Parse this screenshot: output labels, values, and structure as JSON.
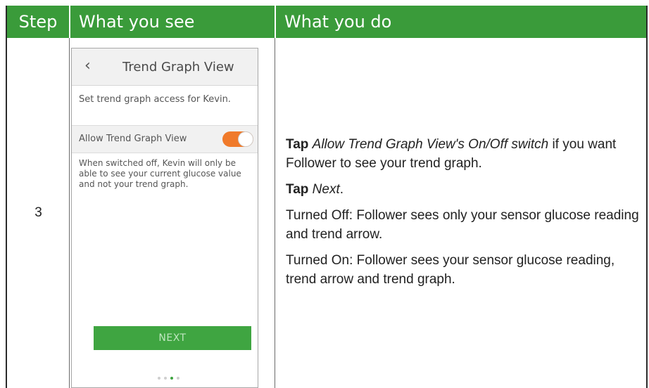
{
  "header": {
    "step": "Step",
    "what_you_see": "What you see",
    "what_you_do": "What you do"
  },
  "row": {
    "step_number": "3",
    "phone": {
      "back_glyph": "‹",
      "title": "Trend Graph View",
      "description": "Set trend graph access for Kevin.",
      "toggle_label": "Allow Trend Graph View",
      "toggle_on": true,
      "note": "When switched off, Kevin will only be able to see your current glucose value and not your trend graph.",
      "next_label": "NEXT",
      "page_dots": 4,
      "active_dot": 3
    },
    "instructions": {
      "p1_verb": "Tap",
      "p1_target": "Allow Trend Graph View's On/Off switch",
      "p1_rest": " if you want Follower to see your trend graph.",
      "p2_verb": "Tap",
      "p2_target": "Next",
      "p2_rest": ".",
      "p3": "Turned Off: Follower sees only your sensor glucose reading and trend arrow.",
      "p4": "Turned On: Follower sees your sensor glucose reading, trend arrow and trend graph."
    }
  },
  "colors": {
    "header_green": "#3a9b3a",
    "toggle_orange": "#f07a2a",
    "button_green": "#3fa541"
  }
}
